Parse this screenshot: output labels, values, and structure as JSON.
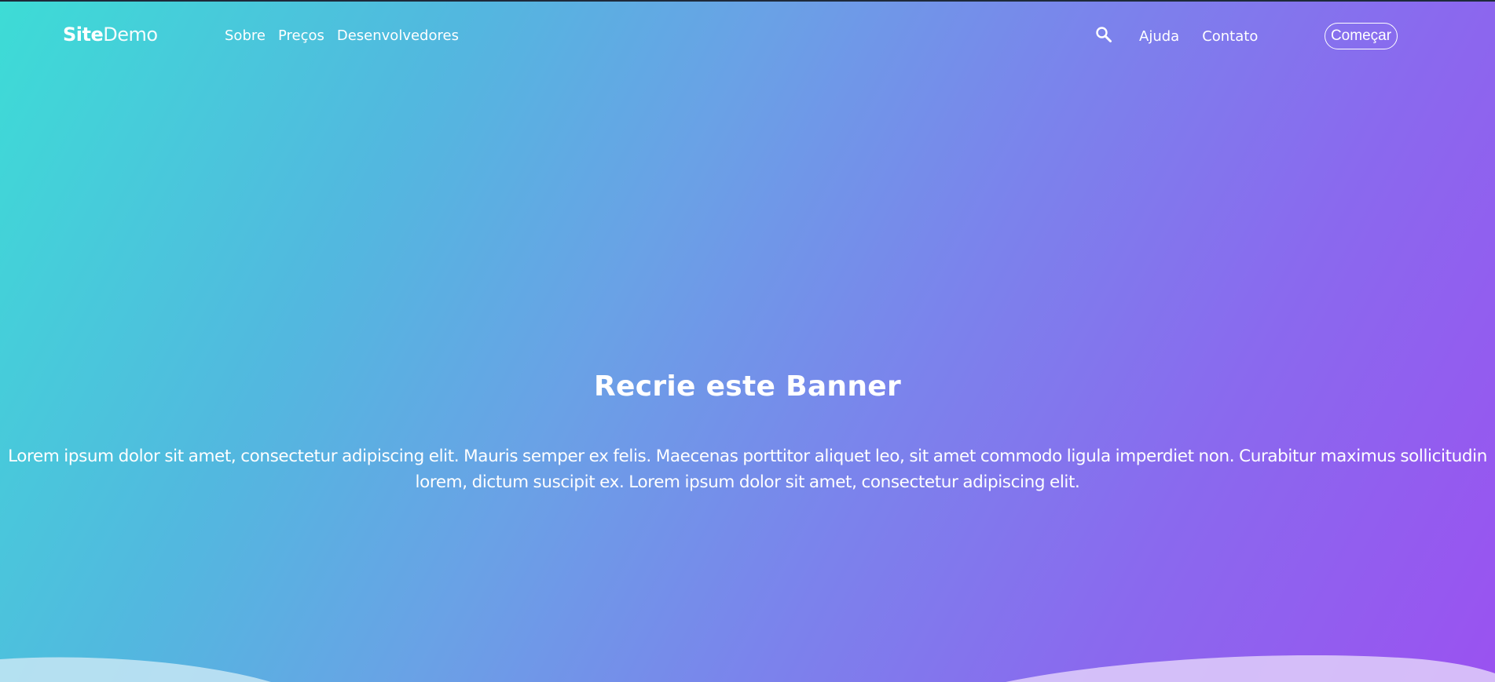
{
  "nav": {
    "logo_strong": "Site",
    "logo_light": "Demo",
    "links": [
      "Sobre",
      "Preços",
      "Desenvolvedores"
    ],
    "search_icon": "search-icon",
    "right_links": [
      "Ajuda",
      "Contato"
    ],
    "cta_label": "Começar"
  },
  "hero": {
    "title": "Recrie este Banner",
    "text": "Lorem ipsum dolor sit amet, consectetur adipiscing elit. Mauris semper ex felis. Maecenas porttitor aliquet leo, sit amet commodo ligula imperdiet non. Curabitur maximus sollicitudin lorem, dictum suscipit ex. Lorem ipsum dolor sit amet, consectetur adipiscing elit."
  },
  "colors": {
    "gradient_start": "#3ddcd6",
    "gradient_mid": "#6aa1e6",
    "gradient_end": "#9a52f0",
    "text": "#ffffff"
  }
}
